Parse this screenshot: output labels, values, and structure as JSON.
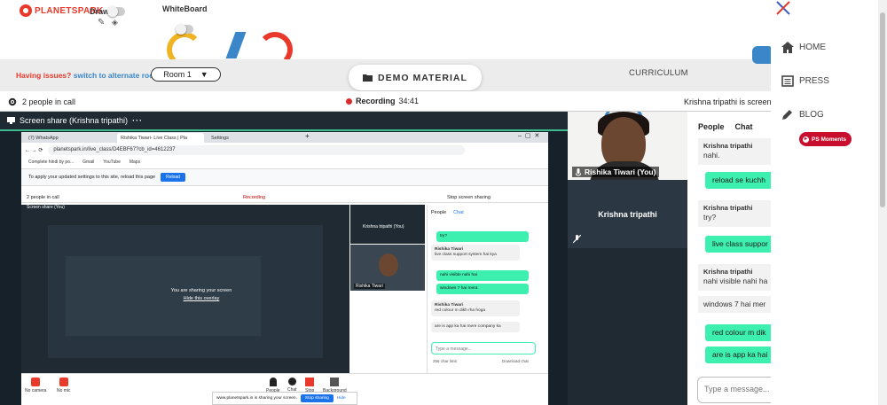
{
  "brand": {
    "name": "PLANETSPARK"
  },
  "toolbar": {
    "draw_label": "Draw",
    "whiteboard_label": "WhiteBoard"
  },
  "sidemenu": {
    "items": [
      {
        "label": "HOME",
        "icon": "home-icon"
      },
      {
        "label": "PRESS",
        "icon": "newspaper-icon"
      },
      {
        "label": "BLOG",
        "icon": "pencil-icon"
      }
    ],
    "ps_moments": "PS Moments"
  },
  "banner": {
    "issues_text": "Having issues?",
    "switch_link": "switch to alternate room",
    "room": "Room 1",
    "demo_material": "DEMO MATERIAL",
    "curriculum": "CURRICULUM"
  },
  "call": {
    "people": "2 people in call",
    "recording_label": "Recording",
    "recording_time": "34:41",
    "right_status": "Krishna tripathi is screen",
    "share_title": "Screen share (Krishna tripathi)"
  },
  "inner": {
    "tabs": [
      "(7) WhatsApp",
      "Rishika Tiwari- Live Class | Pla",
      "Settings"
    ],
    "url": "planetspark.in/live_class/D4EBF67?cb_id=4612237",
    "bookmarks": [
      "Complete hindi by po...",
      "Gmail",
      "YouTube",
      "Maps"
    ],
    "infobar": "To apply your updated settings to this site, reload this page",
    "reload": "Reload",
    "people": "2 people in call",
    "recording": "Recording",
    "stop_share": "Stop screen sharing",
    "share_title": "Screen share (You)",
    "overlay1": "You are sharing your screen",
    "overlay2": "Hide this overlay",
    "tile1": "Krishna tripathi (You)",
    "tile2": "Rishika Tiwari",
    "chat_tabs": [
      "People",
      "Chat"
    ],
    "msgs": [
      {
        "type": "me",
        "text": "try?"
      },
      {
        "type": "sys",
        "who": "Rishika Tiwari",
        "text": "live class support system hai kya"
      },
      {
        "type": "me",
        "text": "nahi visible nahi hai"
      },
      {
        "type": "me",
        "text": "windows 7 hai mera"
      },
      {
        "type": "sys",
        "who": "Rishika Tiwari",
        "text": "red colour m dikh rha hoga"
      },
      {
        "type": "sys",
        "who": "",
        "text": "are is app ka hai mere company ka"
      }
    ],
    "input_placeholder": "Type a message...",
    "char_limit": "256 char limit",
    "download_chat": "Download chat",
    "controls": [
      "No camera",
      "No mic",
      "People",
      "Chat",
      "Stop",
      "Background"
    ],
    "sharebar_text": "www.planetspark.in is sharing your screen.",
    "stop_sharing": "Stop sharing",
    "hide": "Hide"
  },
  "tiles": {
    "you": "Rishika Tiwari (You)",
    "other": "Krishna tripathi"
  },
  "chat": {
    "tabs": [
      "People",
      "Chat"
    ],
    "messages": [
      {
        "type": "sys",
        "who": "Krishna tripathi",
        "text": "nahi."
      },
      {
        "type": "me",
        "text": "reload se kuchh"
      },
      {
        "type": "sys",
        "who": "Krishna tripathi",
        "text": "try?"
      },
      {
        "type": "me",
        "text": "live class suppor"
      },
      {
        "type": "sys",
        "who": "Krishna tripathi",
        "text": "nahi visible nahi ha"
      },
      {
        "type": "sys",
        "who": "",
        "text": "windows 7 hai mer"
      },
      {
        "type": "me",
        "text": "red colour m dik"
      },
      {
        "type": "me",
        "text": "are is app ka hai"
      }
    ],
    "input_placeholder": "Type a message..."
  },
  "colors": {
    "brand_red": "#e8392b",
    "link_blue": "#3a86c8",
    "chat_green": "#3ef0b0",
    "dark": "#1f2a33"
  }
}
